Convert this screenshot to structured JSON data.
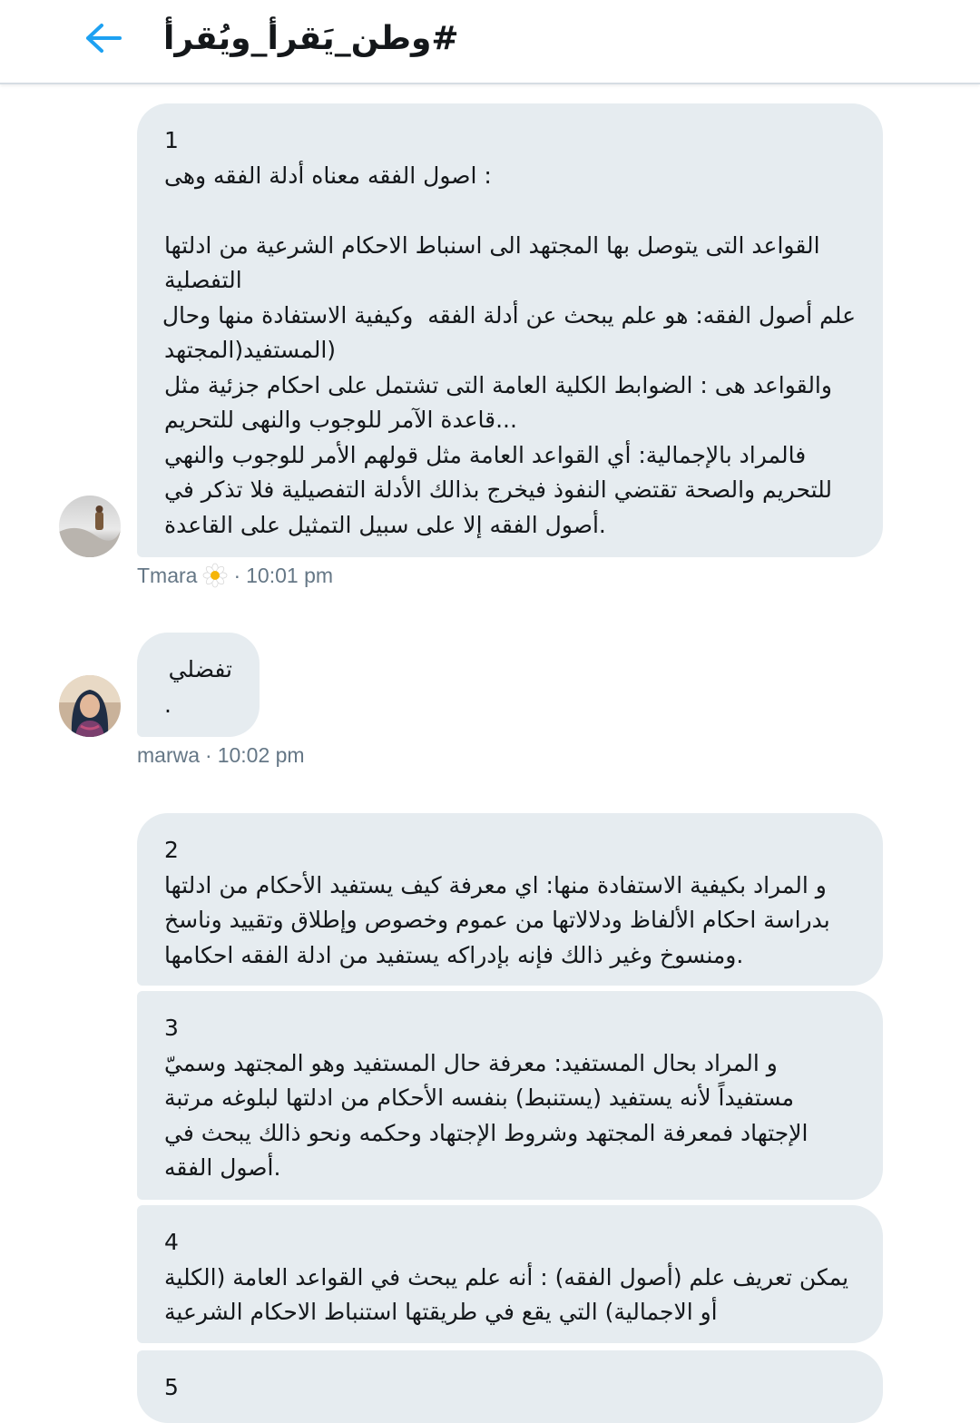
{
  "header": {
    "title": "#وطن_يَقرأ_ويُقرأ",
    "accent_color": "#1da1f2"
  },
  "messages": [
    {
      "lines": [
        "1",
        ": اصول الفقه معناه أدلة الفقه وهى",
        "",
        "القواعد التى يتوصل بها المجتهد الى اسنباط الاحكام الشرعية من ادلتها",
        "التفصلية",
        "علم أصول الفقه: هو علم يبحث عن أدلة الفقه  وكيفية الاستفادة منها وحال",
        "(المستفيد(المجتهد",
        "والقواعد هى : الضوابط الكلية العامة التى تشتمل على احكام جزئية مثل",
        "...قاعدة الآمر للوجوب والنهى للتحريم",
        "فالمراد بالإجمالية: أي القواعد العامة مثل قولهم الأمر للوجوب والنهي",
        "للتحريم والصحة تقتضي النفوذ فيخرج بذالك الأدلة التفصيلية فلا تذكر في",
        ".أصول الفقه إلا على سبيل التمثيل على القاعدة"
      ]
    },
    {
      "lines": [
        "تفضلي",
        "."
      ]
    },
    {
      "lines": [
        "2",
        "و المراد بكيفية الاستفادة منها: اي معرفة كيف يستفيد الأحكام من ادلتها",
        "بدراسة احكام الألفاظ ودلالاتها من عموم وخصوص وإطلاق وتقييد وناسخ",
        ".ومنسوخ وغير ذالك فإنه بإدراكه يستفيد من ادلة الفقه احكامها"
      ]
    },
    {
      "lines": [
        "3",
        "و المراد بحال المستفيد: معرفة حال المستفيد وهو المجتهد وسميّ",
        "مستفيداً لأنه يستفيد (يستنبط) بنفسه الأحكام من ادلتها لبلوغه مرتبة",
        "الإجتهاد فمعرفة المجتهد وشروط الإجتهاد وحكمه ونحو ذالك يبحث في",
        ".أصول الفقه"
      ]
    },
    {
      "lines": [
        "4",
        "يمكن تعريف علم (أصول الفقه) : أنه علم يبحث في القواعد العامة (الكلية",
        "أو الاجمالية) التي يقع في طريقتها استنباط الاحكام الشرعية"
      ]
    },
    {
      "lines": [
        "5"
      ]
    }
  ],
  "meta": [
    {
      "name": "Tmara",
      "emoji": "daisy-icon",
      "separator": "·",
      "time": "10:01 pm"
    },
    {
      "name": "marwa",
      "separator": "·",
      "time": "10:02 pm"
    }
  ]
}
